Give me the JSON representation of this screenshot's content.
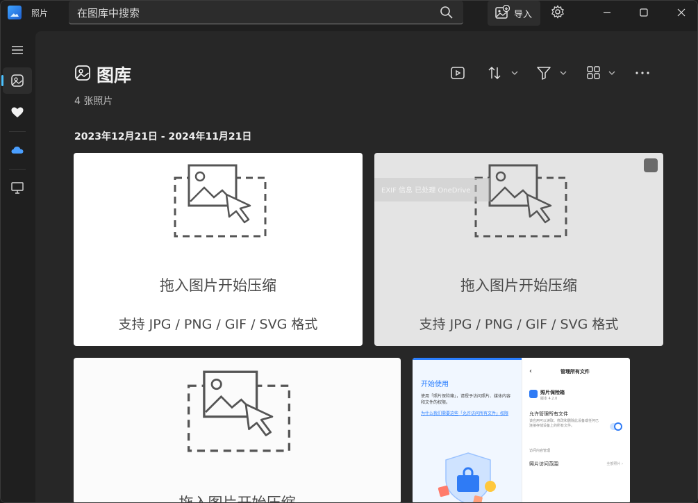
{
  "app": {
    "title": "照片"
  },
  "search": {
    "placeholder": "在图库中搜索"
  },
  "header": {
    "import_label": "导入"
  },
  "colors": {
    "accent": "#4cc2ff",
    "background": "#272727",
    "sidebar": "#1f1f1f"
  },
  "sidebar": {
    "items": [
      {
        "name": "menu",
        "icon": "hamburger-icon"
      },
      {
        "name": "gallery",
        "icon": "gallery-icon",
        "active": true
      },
      {
        "name": "favorites",
        "icon": "heart-icon"
      },
      {
        "name": "onedrive",
        "icon": "cloud-icon"
      },
      {
        "name": "this-pc",
        "icon": "monitor-icon"
      }
    ]
  },
  "main": {
    "title": "图库",
    "photo_count": "4 张照片",
    "date_range": "2023年12月21日 - 2024年11月21日",
    "toolbar": [
      "slideshow-icon",
      "sort-icon",
      "filter-icon",
      "view-icon",
      "more-icon"
    ]
  },
  "tiles": [
    {
      "caption_main": "拖入图片开始压缩",
      "caption_sub": "支持 JPG / PNG / GIF / SVG 格式"
    },
    {
      "caption_main": "拖入图片开始压缩",
      "caption_sub": "支持 JPG / PNG / GIF / SVG 格式",
      "overlay": "EXIF  信息  已处理  OneDrive"
    },
    {
      "caption_main": "拖入图片开始压缩"
    },
    {
      "left_title": "开始使用",
      "left_text": "使用「照片保险箱」，请授予访问照片、媒体内容和文件的权限。",
      "left_link": "为什么我们需要这些「允许访问所有文件」权限",
      "right_back": "‹",
      "right_head": "管理所有文件",
      "app_name": "照片保险箱",
      "app_version": "版本 4.2.0",
      "perm_title": "允许管理所有文件",
      "perm_desc": "该应用可以读取、修改和删除此设备或任何已连接存储设备上的所有文件。",
      "section": "访问内容管理",
      "row_label": "照片访问范围",
      "row_value": "全部照片 ›"
    }
  ]
}
